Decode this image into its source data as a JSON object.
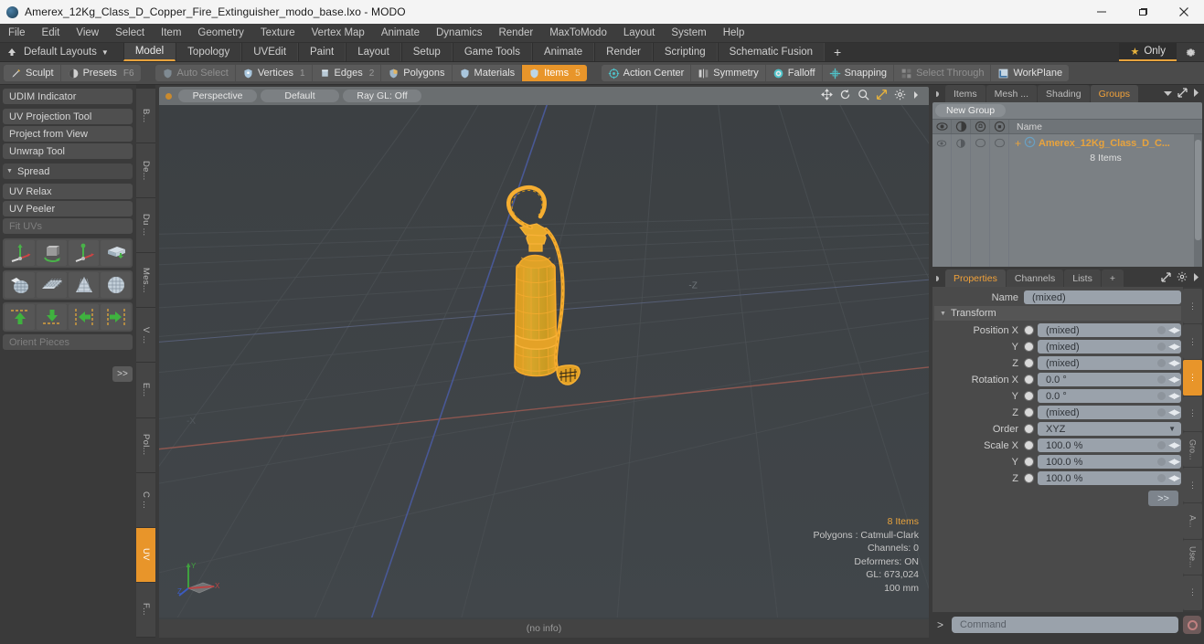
{
  "titlebar": {
    "title": "Amerex_12Kg_Class_D_Copper_Fire_Extinguisher_modo_base.lxo - MODO",
    "minimize": "minimize-icon",
    "maximize": "maximize-icon",
    "close": "close-icon"
  },
  "menubar": {
    "items": [
      "File",
      "Edit",
      "View",
      "Select",
      "Item",
      "Geometry",
      "Texture",
      "Vertex Map",
      "Animate",
      "Dynamics",
      "Render",
      "MaxToModo",
      "Layout",
      "System",
      "Help"
    ]
  },
  "layoutbar": {
    "default_layouts": "Default Layouts",
    "tabs": [
      "Model",
      "Topology",
      "UVEdit",
      "Paint",
      "Layout",
      "Setup",
      "Game Tools",
      "Animate",
      "Render",
      "Scripting",
      "Schematic Fusion"
    ],
    "active_tab": "Model",
    "plus": "+",
    "only_label": "Only",
    "gear": "gear-icon"
  },
  "modebar": {
    "left_group": [
      {
        "label": "Sculpt",
        "icon": "brush-icon",
        "dim": false,
        "active": false,
        "num": ""
      },
      {
        "label": "Presets",
        "icon": "sphere-icon",
        "dim": false,
        "active": false,
        "num": "F6"
      }
    ],
    "select_group": [
      {
        "label": "Auto Select",
        "icon": "shield-icon",
        "dim": true,
        "active": false,
        "num": ""
      },
      {
        "label": "Vertices",
        "icon": "vertex-icon",
        "dim": false,
        "active": false,
        "num": "1"
      },
      {
        "label": "Edges",
        "icon": "edge-icon",
        "dim": false,
        "active": false,
        "num": "2"
      },
      {
        "label": "Polygons",
        "icon": "polygon-icon",
        "dim": false,
        "active": false,
        "num": ""
      },
      {
        "label": "Materials",
        "icon": "material-icon",
        "dim": false,
        "active": false,
        "num": ""
      },
      {
        "label": "Items",
        "icon": "item-icon",
        "dim": false,
        "active": true,
        "num": "5"
      }
    ],
    "right_group": [
      {
        "label": "Action Center",
        "icon": "target-icon",
        "dim": false,
        "active": false,
        "num": ""
      },
      {
        "label": "Symmetry",
        "icon": "symmetry-icon",
        "dim": false,
        "active": false,
        "num": ""
      },
      {
        "label": "Falloff",
        "icon": "falloff-icon",
        "dim": false,
        "active": false,
        "num": ""
      },
      {
        "label": "Snapping",
        "icon": "snap-icon",
        "dim": false,
        "active": false,
        "num": ""
      },
      {
        "label": "Select Through",
        "icon": "select-through-icon",
        "dim": true,
        "active": false,
        "num": ""
      },
      {
        "label": "WorkPlane",
        "icon": "workplane-icon",
        "dim": false,
        "active": false,
        "num": ""
      }
    ]
  },
  "leftpanel": {
    "rows": [
      {
        "label": "UDIM Indicator",
        "dim": false,
        "sep": true,
        "header": false
      },
      {
        "label": "UV Projection Tool",
        "dim": false,
        "sep": false,
        "header": false
      },
      {
        "label": "Project from View",
        "dim": false,
        "sep": false,
        "header": false
      },
      {
        "label": "Unwrap Tool",
        "dim": false,
        "sep": true,
        "header": false
      },
      {
        "label": "Spread",
        "dim": false,
        "sep": true,
        "header": true
      },
      {
        "label": "UV Relax",
        "dim": false,
        "sep": false,
        "header": false
      },
      {
        "label": "UV Peeler",
        "dim": false,
        "sep": false,
        "header": false
      },
      {
        "label": "Fit UVs",
        "dim": true,
        "sep": true,
        "header": false
      }
    ],
    "grid1": [
      "move-gizmo-icon",
      "rotate-gizmo-icon",
      "scale-gizmo-icon",
      "flip-plane-icon"
    ],
    "grid2": [
      "uv-unwrap-icon",
      "uv-grid-plane-icon",
      "uv-cone-icon",
      "uv-sphere-icon"
    ],
    "grid3": [
      "align-up-icon",
      "align-down-icon",
      "align-left-icon",
      "align-right-icon"
    ],
    "orient_pieces": "Orient Pieces",
    "expand": ">>",
    "vtabs": [
      "B...",
      "De...",
      "Du ...",
      "Mes...",
      "V ...",
      "E...",
      "Pol...",
      "C ...",
      "UV",
      "F..."
    ],
    "vtab_active": "UV"
  },
  "viewport": {
    "perspective": "Perspective",
    "shading": "Default",
    "raygl": "Ray GL: Off",
    "header_icons": [
      "pan-icon",
      "rotate-icon",
      "zoom-icon",
      "fit-icon",
      "gear-icon",
      "chevron-right-icon"
    ],
    "info": {
      "items": "8 Items",
      "polygons": "Polygons : Catmull-Clark",
      "channels": "Channels: 0",
      "deformers": "Deformers: ON",
      "gl": "GL: 673,024",
      "scale": "100 mm"
    },
    "status": "(no info)",
    "axis_labels": {
      "x": "X",
      "y": "Y",
      "z": "Z"
    },
    "model_color": "#f0a030"
  },
  "rightpanel": {
    "top_tabs": [
      {
        "label": "Items",
        "active": false
      },
      {
        "label": "Mesh ...",
        "active": false
      },
      {
        "label": "Shading",
        "active": false
      },
      {
        "label": "Groups",
        "active": true
      }
    ],
    "top_tab_extra": [
      "chevron-down-icon",
      "expand-icon",
      "chevron-right-icon"
    ],
    "new_group": "New Group",
    "columns": [
      "eye-icon",
      "render-icon",
      "lock-icon",
      "wireframe-icon"
    ],
    "name_header": "Name",
    "item_name": "Amerex_12Kg_Class_D_C...",
    "item_sub": "8 Items"
  },
  "properties": {
    "tabs": [
      {
        "label": "Properties",
        "active": true
      },
      {
        "label": "Channels",
        "active": false
      },
      {
        "label": "Lists",
        "active": false
      },
      {
        "label": "+",
        "active": false
      }
    ],
    "tab_icons": [
      "expand-icon",
      "gear-icon",
      "chevron-right-icon"
    ],
    "name_label": "Name",
    "name_value": "(mixed)",
    "transform_section": "Transform",
    "fields": [
      {
        "label": "Position X",
        "value": "(mixed)"
      },
      {
        "label": "Y",
        "value": "(mixed)"
      },
      {
        "label": "Z",
        "value": "(mixed)"
      },
      {
        "label": "Rotation X",
        "value": "0.0 °"
      },
      {
        "label": "Y",
        "value": "0.0 °"
      },
      {
        "label": "Z",
        "value": "(mixed)"
      }
    ],
    "order_label": "Order",
    "order_value": "XYZ",
    "scale_fields": [
      {
        "label": "Scale X",
        "value": "100.0 %"
      },
      {
        "label": "Y",
        "value": "100.0 %"
      },
      {
        "label": "Z",
        "value": "100.0 %"
      }
    ],
    "expand": ">>",
    "vtabs": [
      "...",
      "...",
      "...",
      "...",
      "Gro...",
      "...",
      "A...",
      "Use...",
      "..."
    ],
    "vtab_active_index": 2
  },
  "command": {
    "prompt": ">",
    "placeholder": "Command",
    "record": "record-icon"
  },
  "colors": {
    "accent": "#e8952a",
    "highlight": "#e8a33d",
    "title_bg": "#f4f4f4",
    "panel_bg": "#3a3a3a",
    "viewport_bg": "#3e4245",
    "field_bg": "#9aa2ab",
    "group_bg": "#7b8084"
  }
}
